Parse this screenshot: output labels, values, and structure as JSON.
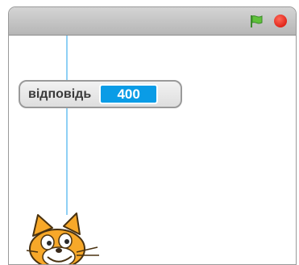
{
  "stage": {
    "controls": {
      "flag_icon": "green-flag-icon",
      "stop_icon": "stop-icon"
    },
    "variable_monitor": {
      "label": "відповідь",
      "value": "400"
    },
    "pen_line_color": "#8fd0f5",
    "sprite": "cat-sprite"
  }
}
